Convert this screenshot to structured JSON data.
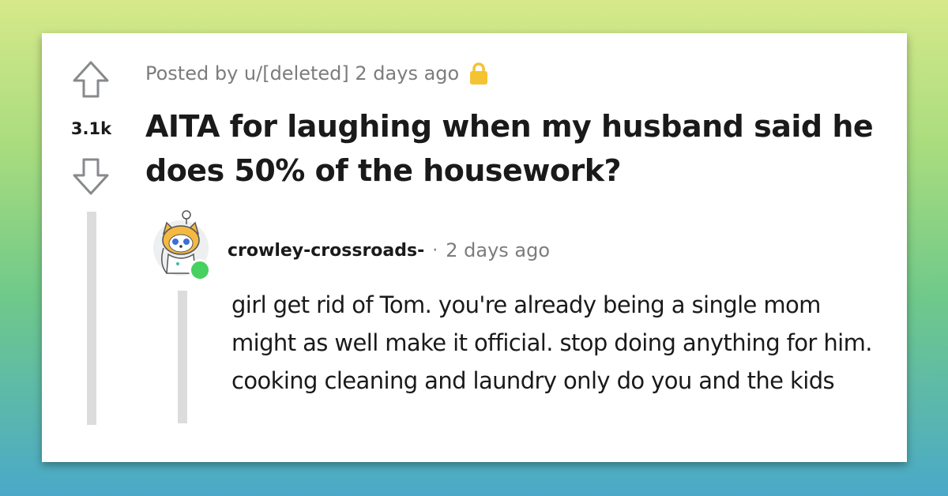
{
  "post": {
    "meta": "Posted by u/[deleted] 2 days ago",
    "title": "AITA for laughing when my husband said he does 50% of the housework?",
    "score": "3.1k"
  },
  "comment": {
    "author": "crowley-crossroads-",
    "separator": "·",
    "time": "2 days ago",
    "body": "girl get rid of Tom. you're already being a single mom might as well make it official. stop doing anything for him. cooking cleaning and laundry only do you and the kids"
  },
  "icons": {
    "upvote": "upvote-arrow-icon",
    "downvote": "downvote-arrow-icon",
    "lock": "lock-icon",
    "avatar": "user-avatar",
    "online": "online-status-icon"
  },
  "colors": {
    "lock": "#f4c331",
    "online": "#46d160",
    "text": "#1a1a1b",
    "muted": "#7c7c7c"
  }
}
